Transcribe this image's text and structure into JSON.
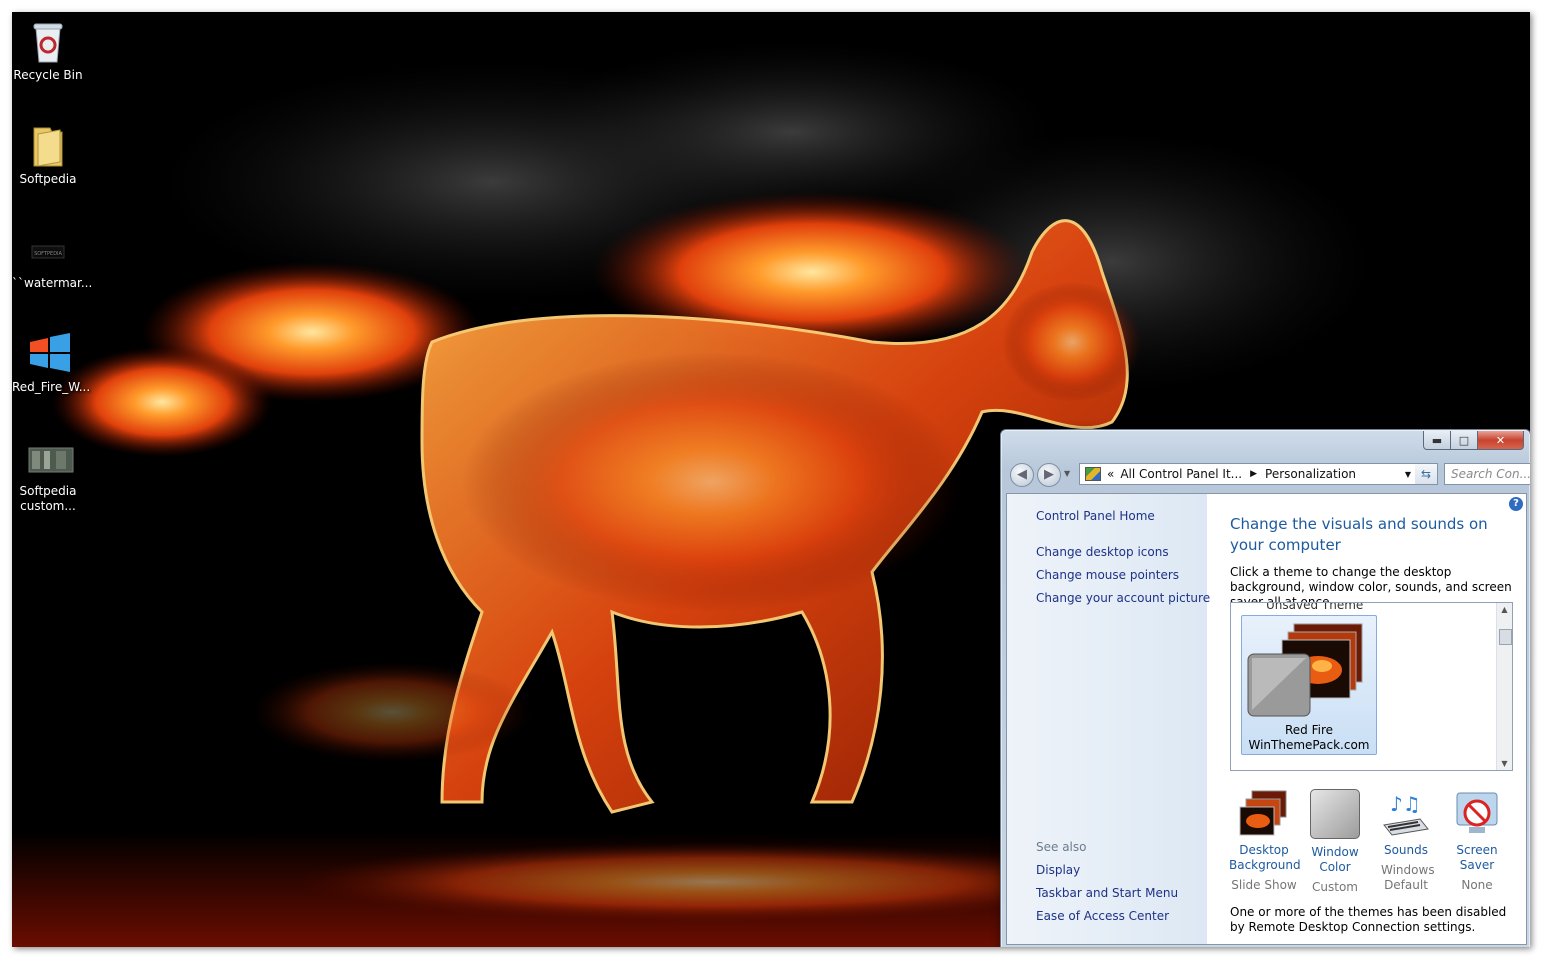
{
  "desktop": {
    "icons": [
      {
        "label": "Recycle Bin"
      },
      {
        "label": "Softpedia"
      },
      {
        "label": "``watermar..."
      },
      {
        "label": "Red_Fire_W..."
      },
      {
        "label": "Softpedia custom..."
      }
    ]
  },
  "window": {
    "controls": {
      "minimize": "▬",
      "maximize": "□",
      "close": "✕"
    },
    "address": {
      "root": "All Control Panel It...",
      "current": "Personalization"
    },
    "search_placeholder": "Search Con...",
    "left_pane": {
      "home": "Control Panel Home",
      "links": [
        "Change desktop icons",
        "Change mouse pointers",
        "Change your account picture"
      ],
      "see_also_title": "See also",
      "see_also": [
        "Display",
        "Taskbar and Start Menu",
        "Ease of Access Center"
      ]
    },
    "heading": "Change the visuals and sounds on your computer",
    "description": "Click a theme to change the desktop background, window color, sounds, and screen saver all at once.",
    "theme_group": "Unsaved Theme",
    "selected_theme": {
      "line1": "Red Fire",
      "line2": "WinThemePack.com"
    },
    "settings": [
      {
        "title1": "Desktop",
        "title2": "Background",
        "sub": "Slide Show",
        "icon": "desktop-background-icon"
      },
      {
        "title1": "Window",
        "title2": "Color",
        "sub": "Custom",
        "icon": "window-color-icon"
      },
      {
        "title1": "Sounds",
        "title2": "",
        "sub": "Windows Default",
        "icon": "sounds-icon"
      },
      {
        "title1": "Screen Saver",
        "title2": "",
        "sub": "None",
        "icon": "screen-saver-icon"
      }
    ],
    "notice": "One or more of the themes has been disabled by Remote Desktop Connection settings."
  },
  "colors": {
    "link": "#1e3287",
    "heading": "#1e5aa0",
    "close_button": "#c8432e"
  }
}
